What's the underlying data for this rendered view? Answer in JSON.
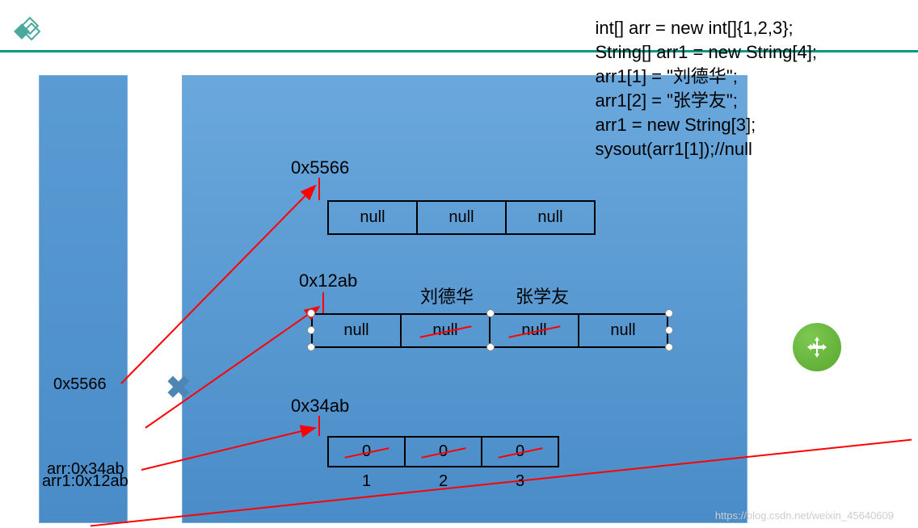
{
  "code": {
    "line1": "int[] arr = new int[]{1,2,3};",
    "line2": "String[] arr1 = new String[4];",
    "line3": "arr1[1] = \"刘德华\";",
    "line4": "arr1[2] = \"张学友\";",
    "line5": "arr1 = new String[3];",
    "line6": "sysout(arr1[1]);//null"
  },
  "heap": {
    "arr5566": {
      "address": "0x5566",
      "cells": [
        "null",
        "null",
        "null"
      ]
    },
    "arr12ab": {
      "address": "0x12ab",
      "cells": [
        "null",
        "null",
        "null",
        "null"
      ],
      "overlay1": "刘德华",
      "overlay2": "张学友"
    },
    "arr34ab": {
      "address": "0x34ab",
      "cells": [
        "0",
        "0",
        "0"
      ],
      "indices": [
        "1",
        "2",
        "3"
      ]
    }
  },
  "stack": {
    "label_5566": "0x5566",
    "label_arr1": "arr1:0x12ab",
    "label_arr": "arr:0x34ab"
  },
  "watermark": "https://blog.csdn.net/weixin_45640609"
}
